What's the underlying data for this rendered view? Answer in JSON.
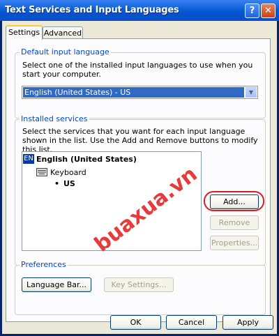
{
  "window": {
    "title": "Text Services and Input Languages",
    "help_label": "?",
    "close_label": "✕"
  },
  "tabs": [
    {
      "label": "Settings",
      "active": true
    },
    {
      "label": "Advanced",
      "active": false
    }
  ],
  "default_input": {
    "group_label": "Default input language",
    "description": "Select one of the installed input languages to use when you start your computer.",
    "selected_value": "English (United States) - US"
  },
  "installed": {
    "group_label": "Installed services",
    "description": "Select the services that you want for each input language shown in the list. Use the Add and Remove buttons to modify this list.",
    "tree": {
      "lang_badge": "EN",
      "language": "English (United States)",
      "category": "Keyboard",
      "bullet": "•",
      "layout": "US"
    },
    "add_label": "Add...",
    "remove_label": "Remove",
    "properties_label": "Properties..."
  },
  "preferences": {
    "group_label": "Preferences",
    "language_bar_label": "Language Bar...",
    "key_settings_label": "Key Settings..."
  },
  "footer": {
    "ok_label": "OK",
    "cancel_label": "Cancel",
    "apply_label": "Apply"
  },
  "watermark": "buaxua.vn",
  "colors": {
    "titlebar": "#0554d1",
    "group_label": "#0046d5",
    "selection": "#316ac5",
    "annotation": "#d62020"
  }
}
